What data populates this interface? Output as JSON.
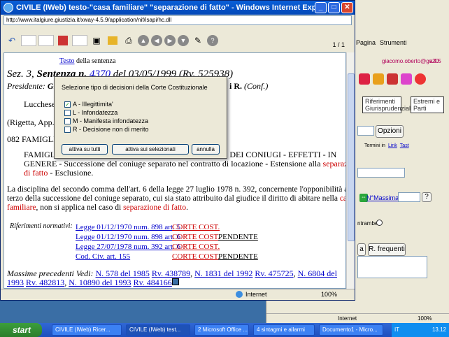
{
  "background_window": {
    "menu_pagina": "Pagina",
    "menu_strumenti": "Strumenti",
    "user": "giacomo.oberto@ga20",
    "version": "v.4.5",
    "tab_riferimenti": "Riferimenti Giurisprudenziali",
    "tab_estremi": "Estremi e Parti",
    "btn_opzioni": "Opzioni",
    "termini_label": "Termini in",
    "termini_link": "Link",
    "termini_tast": "Tast",
    "nmassima_label": "N°Massima",
    "entrambe_label": "ntrambe",
    "btn_a": "a",
    "btn_frequenti": "R. frequenti",
    "status": "Internet",
    "zoom": "100%"
  },
  "window": {
    "title": "CIVILE (IWeb) testo-\"casa familiare\" \"separazione di fatto\" - Windows Internet Explorer",
    "url": "http://www.italgiure.giustizia.it/xway-4.5.9/application/nif/isapi/hc.dll",
    "page_indicator": "1 / 1",
    "status_zone": "Internet",
    "zoom": "100%"
  },
  "document": {
    "testo_link": "Testo",
    "testo_rest": " della sentenza",
    "sez_line_a": "Sez. 3, ",
    "sez_line_b": "Sentenza n. ",
    "sez_num": "4370",
    "sez_line_c": " del 03/05/1999 (Rv. 525938)",
    "presidente": "Presidente: ",
    "presidente_rest": "Gi",
    "relatore_end": "i R. ",
    "conf": "(Conf.)",
    "lucchese": "Lucchese",
    "rigetta": "(Rigetta, App.",
    "famiglia": "082 FAMIGLI",
    "famig2": "FAMIGLI",
    "famig2_end": "E DEI CONIUGI - EFFETTI - IN",
    "genere_a": "GENERE - Successione del coniuge separato nel contratto di locazione - Estensione alla ",
    "genere_red": "separazione",
    "line3_red": "di fatto",
    "line3_rest": " - Esclusione.",
    "para1": "La disciplina del secondo comma dell'art. 6 della legge 27 luglio 1978 n. 392, concernente l'opponibilità al",
    "para2": "terzo della successione del coniuge separato, cui sia stato attribuito dal giudice il diritto di abitare nella ",
    "para2_red": "casa",
    "para3_red": "familiare",
    "para3_mid": ", non si applica nel caso di ",
    "para3_red2": "separazione di fatto",
    "para3_end": ".",
    "rif_label": "Riferimenti normativi:",
    "refs": [
      {
        "law": "Legge 01/12/1970 num. 898 art. 5",
        "court": "CORTE COST.",
        "status": ""
      },
      {
        "law": "Legge 01/12/1970 num. 898 art. 6",
        "court": "CORTE COST.",
        "status": "PENDENTE"
      },
      {
        "law": "Legge 27/07/1978 num. 392 art. 6",
        "court": "CORTE COST.",
        "status": ""
      },
      {
        "law": "Cod. Civ. art. 155",
        "court": "CORTE COST.",
        "status": "PENDENTE"
      }
    ],
    "massime_label": "Massime precedenti Vedi: ",
    "massime1": "N. 578 del 1985",
    "massime2": "Rv. 438789",
    "massime3": "N. 1831 del 1992",
    "massime4": "Rv. 475725",
    "massime5": "N. 6804 del",
    "massime6": "1993",
    "massime7": "Rv. 482813",
    "massime8": "N. 10890 del 1993",
    "massime9": "Rv. 484166"
  },
  "dialog": {
    "title": "Selezione tipo di decisioni della Corte Costituzionale",
    "options": [
      {
        "label": "A - Illegittimita'",
        "checked": true
      },
      {
        "label": "L - Infondatezza",
        "checked": false
      },
      {
        "label": "M - Manifesta infondatezza",
        "checked": false
      },
      {
        "label": "R - Decisione non di merito",
        "checked": false
      }
    ],
    "btn_all": "attiva su tutti",
    "btn_selected": "attiva sui selezionati",
    "btn_cancel": "annulla"
  },
  "taskbar": {
    "start": "start",
    "tasks": [
      "CIVILE (IWeb) Ricer...",
      "CIVILE (IWeb) test...",
      "2 Microsoft Office ...",
      "4 sintagmi e allarmi",
      "Documento1 - Micro..."
    ],
    "lang": "IT",
    "time": "13.12"
  }
}
